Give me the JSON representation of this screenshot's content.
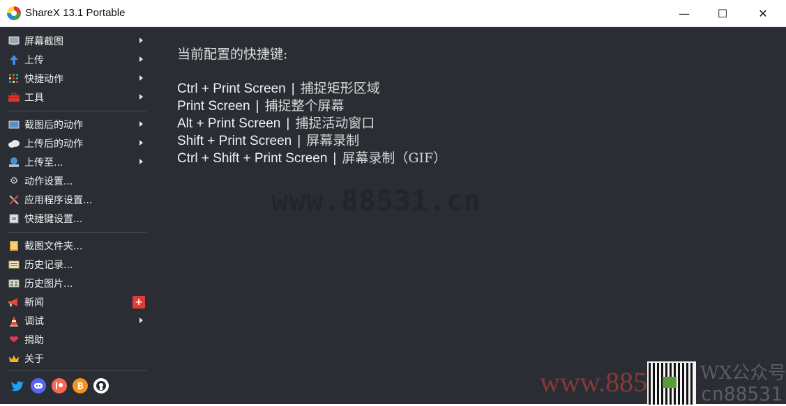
{
  "window": {
    "title": "ShareX 13.1 Portable"
  },
  "titlebar": {
    "minimize_glyph": "—",
    "maximize_glyph": "☐",
    "close_glyph": "✕"
  },
  "sidebar": {
    "items": [
      {
        "label": "屏幕截图",
        "icon": "monitor-icon",
        "submenu": true
      },
      {
        "label": "上传",
        "icon": "upload-arrow-icon",
        "submenu": true
      },
      {
        "label": "快捷动作",
        "icon": "grid-dots-icon",
        "submenu": true
      },
      {
        "label": "工具",
        "icon": "toolbox-icon",
        "submenu": true
      },
      {
        "label": "截图后的动作",
        "icon": "capture-tasks-icon",
        "submenu": true
      },
      {
        "label": "上传后的动作",
        "icon": "cloud-icon",
        "submenu": true
      },
      {
        "label": "上传至...",
        "icon": "upload-destination-icon",
        "submenu": true
      },
      {
        "label": "动作设置...",
        "icon": "gear-icon",
        "submenu": false
      },
      {
        "label": "应用程序设置...",
        "icon": "wrench-screwdriver-icon",
        "submenu": false
      },
      {
        "label": "快捷键设置...",
        "icon": "keyboard-icon",
        "submenu": false
      },
      {
        "label": "截图文件夹...",
        "icon": "folder-icon",
        "submenu": false
      },
      {
        "label": "历史记录...",
        "icon": "history-icon",
        "submenu": false
      },
      {
        "label": "历史图片...",
        "icon": "image-history-icon",
        "submenu": false
      },
      {
        "label": "新闻",
        "icon": "megaphone-icon",
        "submenu": false,
        "badge": "+"
      },
      {
        "label": "调试",
        "icon": "traffic-cone-icon",
        "submenu": true
      },
      {
        "label": "捐助",
        "icon": "heart-icon",
        "submenu": false
      },
      {
        "label": "关于",
        "icon": "crown-icon",
        "submenu": false
      }
    ],
    "social": [
      {
        "name": "twitter-icon",
        "color": "#1da1f2",
        "glyph": "t"
      },
      {
        "name": "discord-icon",
        "color": "#5865f2",
        "glyph": "d"
      },
      {
        "name": "patreon-icon",
        "color": "#f96854",
        "glyph": "P"
      },
      {
        "name": "bitcoin-icon",
        "color": "#f7931a",
        "glyph": "₿"
      },
      {
        "name": "github-icon",
        "color": "#24292e",
        "glyph": "G"
      }
    ]
  },
  "content": {
    "heading": "当前配置的快捷键:",
    "separator": "|",
    "hotkeys": [
      {
        "keys": "Ctrl + Print Screen",
        "action": "捕捉矩形区域"
      },
      {
        "keys": "Print Screen",
        "action": "捕捉整个屏幕"
      },
      {
        "keys": "Alt + Print Screen",
        "action": "捕捉活动窗口"
      },
      {
        "keys": "Shift + Print Screen",
        "action": "屏幕录制"
      },
      {
        "keys": "Ctrl + Shift + Print Screen",
        "action": "屏幕录制（GIF）"
      }
    ]
  },
  "watermarks": {
    "center": "www.88531.cn",
    "corner_red": "www.88531",
    "corner_gray_top": "WX公众号",
    "corner_gray_bottom": "cn88531"
  }
}
